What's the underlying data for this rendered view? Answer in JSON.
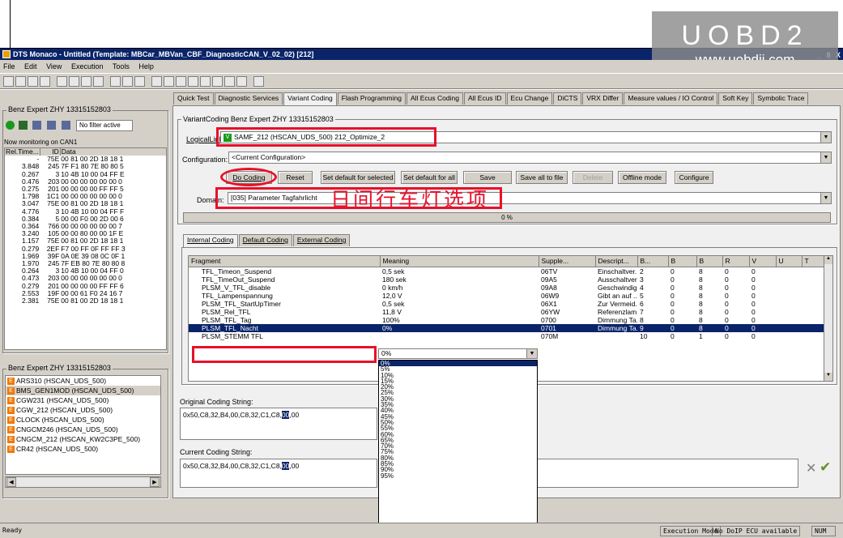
{
  "watermark": {
    "title": "UOBD2",
    "url": "www.uobdii.com"
  },
  "window": {
    "title": "DTS Monaco  - Untitled (Template: MBCar_MBVan_CBF_DiagnosticCAN_V_02_02) [212]",
    "min": "_",
    "max": "8",
    "close": "X"
  },
  "menu": [
    "File",
    "Edit",
    "View",
    "Execution",
    "Tools",
    "Help"
  ],
  "left": {
    "group1_label": "Benz Expert ZHY 13315152803",
    "filter": "No filter active",
    "monitoring": "Now monitoring on CAN1",
    "can_headers": [
      "Rel.Time...",
      "ID",
      "Data"
    ],
    "can_rows": [
      [
        "-",
        "75E",
        "00 81 00 2D 18 18 1"
      ],
      [
        "3.848",
        "245",
        "7F F1 80 7E 80 80 5"
      ],
      [
        "0.267",
        "3",
        "10 4B 10 00 04 FF E"
      ],
      [
        "0.476",
        "203",
        "00 00 00 00 00 00 0"
      ],
      [
        "0.275",
        "201",
        "00 00 00 00 FF FF 5"
      ],
      [
        "1.798",
        "1C1",
        "00 00 00 00 00 00 0"
      ],
      [
        "3.047",
        "75E",
        "00 81 00 2D 18 18 1"
      ],
      [
        "4.776",
        "3",
        "10 4B 10 00 04 FF F"
      ],
      [
        "0.384",
        "5",
        "00 00 F0 00 2D 00 6"
      ],
      [
        "0.364",
        "766",
        "00 00 00 00 00 00 7"
      ],
      [
        "3.240",
        "105",
        "00 00 80 00 00 1F E"
      ],
      [
        "1.157",
        "75E",
        "00 81 00 2D 18 18 1"
      ],
      [
        "0.279",
        "2EF",
        "F7 00 FF 0F FF FF 3"
      ],
      [
        "1.969",
        "39F",
        "0A 0E 39 08 0C 0F 1"
      ],
      [
        "1.970",
        "245",
        "7F EB 80 7E 80 80 8"
      ],
      [
        "0.264",
        "3",
        "10 4B 10 00 04 FF 0"
      ],
      [
        "0.473",
        "203",
        "00 00 00 00 00 00 0"
      ],
      [
        "0.279",
        "201",
        "00 00 00 00 FF FF 6"
      ],
      [
        "2.553",
        "19F",
        "00 00 61 F0 24 16 7"
      ],
      [
        "2.381",
        "75E",
        "00 81 00 2D 18 18 1"
      ]
    ],
    "group2_label": "Benz Expert  ZHY 13315152803",
    "ecus": [
      "ARS310 (HSCAN_UDS_500)",
      "BMS_GEN1MOD (HSCAN_UDS_500)",
      "CGW231 (HSCAN_UDS_500)",
      "CGW_212 (HSCAN_UDS_500)",
      "CLOCK (HSCAN_UDS_500)",
      "CNGCM246 (HSCAN_UDS_500)",
      "CNGCM_212 (HSCAN_KW2C3PE_500)",
      "CR42 (HSCAN_UDS_500)"
    ],
    "ecu_icon": "E"
  },
  "tabs": [
    "Quick Test",
    "Diagnostic Services",
    "Variant Coding",
    "Flash Programming",
    "All Ecus Coding",
    "All Ecus ID",
    "Ecu Change",
    "DiCTS",
    "VRX Differ",
    "Measure values / IO Control",
    "Soft Key",
    "Symbolic Trace"
  ],
  "vc": {
    "group_label": "VariantCoding Benz Expert ZHY 13315152803",
    "logical_link_label": "LogicalLink:",
    "logical_link_badge": "V",
    "logical_link": "SAMF_212 (HSCAN_UDS_500) 212_Optimize_2",
    "configuration_label": "Configuration:",
    "configuration": "<Current Configuration>",
    "buttons": [
      "Do Coding",
      "Reset",
      "Set default for selected",
      "Set default for all",
      "Save",
      "Save all to file",
      "Delete",
      "Offline mode",
      "Configure"
    ],
    "domain_label": "Domain:",
    "domain": "[035] Parameter Tagfahrlicht",
    "chinese_note": "日间行车灯选项",
    "progress": "0 %",
    "subtabs": [
      "Internal Coding",
      "Default Coding",
      "External Coding"
    ],
    "grid_headers": [
      "Fragment",
      "Meaning",
      "Supple...",
      "Descript...",
      "B...",
      "B",
      "B",
      "R",
      "V",
      "U",
      "T"
    ],
    "grid_rows": [
      [
        "TFL_Timeon_Suspend",
        "0,5 sek",
        "06TV",
        "Einschaltver...",
        "2",
        "0",
        "8",
        "0",
        "0",
        "",
        ""
      ],
      [
        "TFL_TimeOut_Suspend",
        "180 sek",
        "09A5",
        "Ausschaltver...",
        "3",
        "0",
        "8",
        "0",
        "0",
        "",
        ""
      ],
      [
        "PLSM_V_TFL_disable",
        "0 km/h",
        "09A8",
        "Geschwindig...",
        "4",
        "0",
        "8",
        "0",
        "0",
        "",
        ""
      ],
      [
        "TFL_Lampenspannung",
        "12,0 V",
        "06W9",
        "Gibt an auf ...",
        "5",
        "0",
        "8",
        "0",
        "0",
        "",
        ""
      ],
      [
        "PLSM_TFL_StartUpTimer",
        "0,5 sek",
        "06X1",
        "Zur Vermeid...",
        "6",
        "0",
        "8",
        "0",
        "0",
        "",
        ""
      ],
      [
        "PLSM_Rel_TFL",
        "11,8 V",
        "06YW",
        "Referenzlam...",
        "7",
        "0",
        "8",
        "0",
        "0",
        "",
        ""
      ],
      [
        "PLSM_TFL_Tag",
        "100%",
        "0700",
        "Dimmung Ta...",
        "8",
        "0",
        "8",
        "0",
        "0",
        "",
        ""
      ],
      [
        "PLSM_TFL_Nacht",
        "0%",
        "0701",
        "Dimmung Ta...",
        "9",
        "0",
        "8",
        "0",
        "0",
        "",
        ""
      ],
      [
        "PLSM_STEMM TFL",
        "",
        "070M",
        "",
        "10",
        "0",
        "1",
        "0",
        "0",
        "",
        ""
      ]
    ],
    "dropdown_options": [
      "0%",
      "5%",
      "10%",
      "15%",
      "20%",
      "25%",
      "30%",
      "35%",
      "40%",
      "45%",
      "50%",
      "55%",
      "60%",
      "65%",
      "70%",
      "75%",
      "80%",
      "85%",
      "90%",
      "95%"
    ],
    "original_label": "Original Coding String:",
    "original_prefix": "0x50,C8,32,B4,00,C8,32,C1,C8,",
    "original_hl": "00",
    "original_suffix": ",00",
    "current_label": "Current Coding String:",
    "current_prefix": "0x50,C8,32,B4,00,C8,32,C1,C8,",
    "current_hl": "00",
    "current_suffix": ",00",
    "reject_glyph": "✕",
    "accept_glyph": "✔"
  },
  "status": {
    "left": "Ready",
    "mode": "Execution Mode",
    "doip": "No DoIP ECU available",
    "num": "NUM"
  }
}
